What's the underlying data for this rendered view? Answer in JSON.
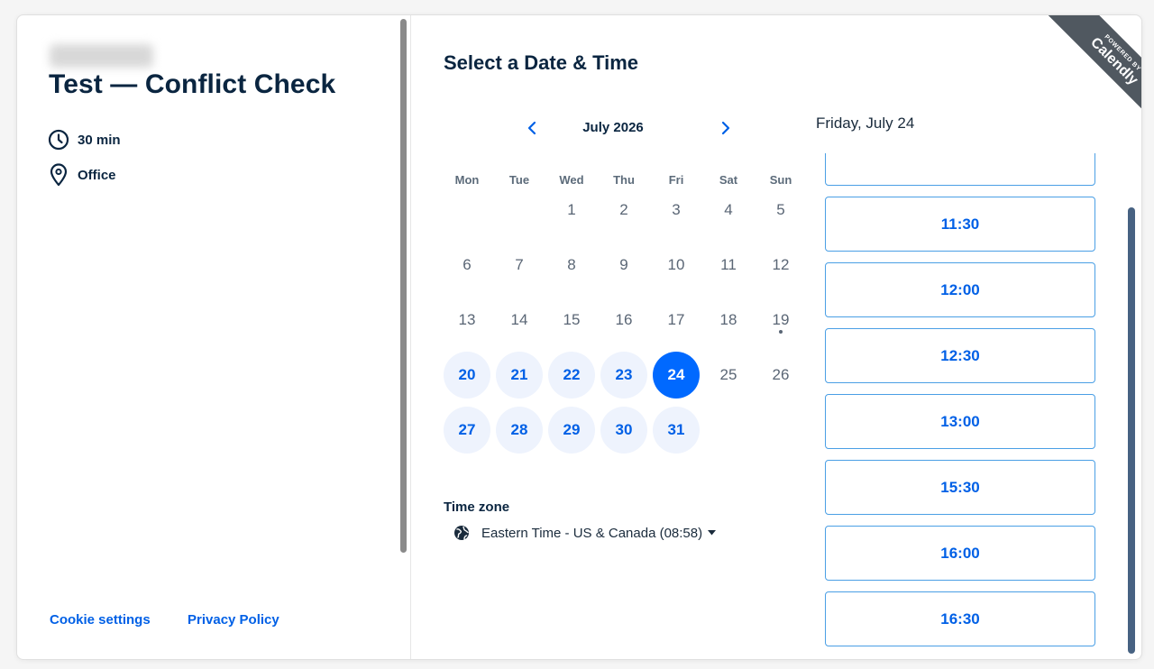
{
  "event": {
    "title": "Test — Conflict Check",
    "duration": "30 min",
    "location": "Office"
  },
  "footer": {
    "cookie_settings": "Cookie settings",
    "privacy_policy": "Privacy Policy"
  },
  "scheduler": {
    "title": "Select a Date & Time",
    "month_label": "July 2026",
    "weekdays": [
      "Mon",
      "Tue",
      "Wed",
      "Thu",
      "Fri",
      "Sat",
      "Sun"
    ],
    "days": [
      {
        "label": "1",
        "status": "unavailable"
      },
      {
        "label": "2",
        "status": "unavailable"
      },
      {
        "label": "3",
        "status": "unavailable"
      },
      {
        "label": "4",
        "status": "unavailable"
      },
      {
        "label": "5",
        "status": "unavailable"
      },
      {
        "label": "6",
        "status": "unavailable"
      },
      {
        "label": "7",
        "status": "unavailable"
      },
      {
        "label": "8",
        "status": "unavailable"
      },
      {
        "label": "9",
        "status": "unavailable"
      },
      {
        "label": "10",
        "status": "unavailable"
      },
      {
        "label": "11",
        "status": "unavailable"
      },
      {
        "label": "12",
        "status": "unavailable"
      },
      {
        "label": "13",
        "status": "unavailable"
      },
      {
        "label": "14",
        "status": "unavailable"
      },
      {
        "label": "15",
        "status": "unavailable"
      },
      {
        "label": "16",
        "status": "unavailable"
      },
      {
        "label": "17",
        "status": "unavailable"
      },
      {
        "label": "18",
        "status": "unavailable"
      },
      {
        "label": "19",
        "status": "today"
      },
      {
        "label": "20",
        "status": "available"
      },
      {
        "label": "21",
        "status": "available"
      },
      {
        "label": "22",
        "status": "available"
      },
      {
        "label": "23",
        "status": "available"
      },
      {
        "label": "24",
        "status": "selected"
      },
      {
        "label": "25",
        "status": "unavailable"
      },
      {
        "label": "26",
        "status": "unavailable"
      },
      {
        "label": "27",
        "status": "available"
      },
      {
        "label": "28",
        "status": "available"
      },
      {
        "label": "29",
        "status": "available"
      },
      {
        "label": "30",
        "status": "available"
      },
      {
        "label": "31",
        "status": "available"
      }
    ],
    "timezone_label": "Time zone",
    "timezone_value": "Eastern Time - US & Canada (08:58)",
    "selected_date": "Friday, July 24",
    "time_slots": [
      "",
      "11:30",
      "12:00",
      "12:30",
      "13:00",
      "15:30",
      "16:00",
      "16:30"
    ]
  },
  "ribbon": {
    "small_text": "POWERED BY",
    "brand": "Calendly"
  },
  "icons": {
    "duration": "clock-icon",
    "location": "location-pin-icon",
    "prev_month": "chevron-left-icon",
    "next_month": "chevron-right-icon",
    "timezone": "globe-icon",
    "timezone_dropdown": "caret-down-icon"
  },
  "colors": {
    "primary": "#0069ff",
    "heading": "#0a2540",
    "available_bg": "#eef3fd",
    "slot_border": "#4a9fe5"
  }
}
